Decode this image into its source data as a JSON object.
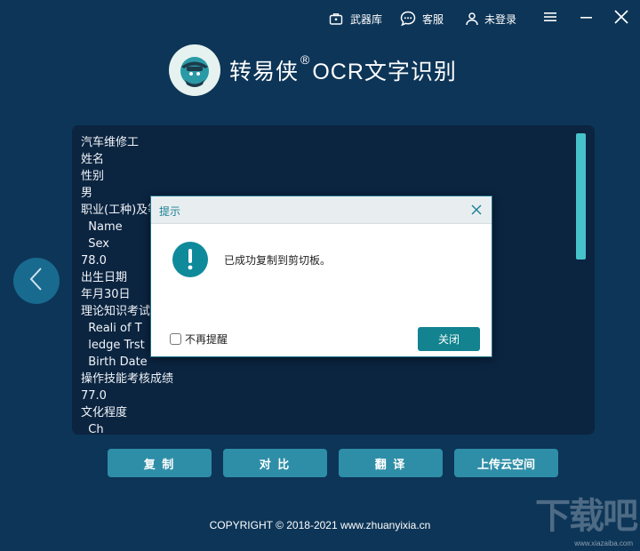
{
  "topbar": {
    "arsenal_label": "武器库",
    "support_label": "客服",
    "login_label": "未登录"
  },
  "brand": {
    "name": "转易侠",
    "reg": "®",
    "product": "OCR文字识别"
  },
  "ocr_text": {
    "lines": [
      "汽车维修工",
      "姓名",
      "性别",
      "男",
      "职业(工种)及等",
      "  Name",
      "  Sex",
      "78.0",
      "出生日期",
      "年月30日",
      "理论知识考试",
      "  Reali of T",
      "  ledge Trst",
      "  Birth Date",
      "操作技能考核成绩",
      "77.0",
      "文化程度",
      "  Ch"
    ]
  },
  "actions": {
    "copy": "复 制",
    "compare": "对 比",
    "translate": "翻 译",
    "upload": "上传云空间"
  },
  "dialog": {
    "title": "提示",
    "message": "已成功复制到剪切板。",
    "checkbox_label": "不再提醒",
    "close_button": "关闭"
  },
  "footer": {
    "copyright": "COPYRIGHT © 2018-2021  www.zhuanyixia.cn"
  },
  "watermark": {
    "big": "下载吧",
    "site": "www.xiazaiba.com"
  },
  "colors": {
    "background": "#0d3557",
    "panel": "#0b2440",
    "button": "#2e8ea7",
    "accent": "#12838f",
    "scrollbar": "#47c3cc"
  },
  "icons": {
    "arsenal": "briefcase-icon",
    "support": "chat-bubble-icon",
    "login": "user-icon",
    "menu": "hamburger-menu-icon",
    "minimize": "minimize-icon",
    "close": "close-icon",
    "nav_prev": "chevron-left-icon",
    "dialog_info": "exclamation-icon",
    "dialog_close": "close-icon"
  }
}
